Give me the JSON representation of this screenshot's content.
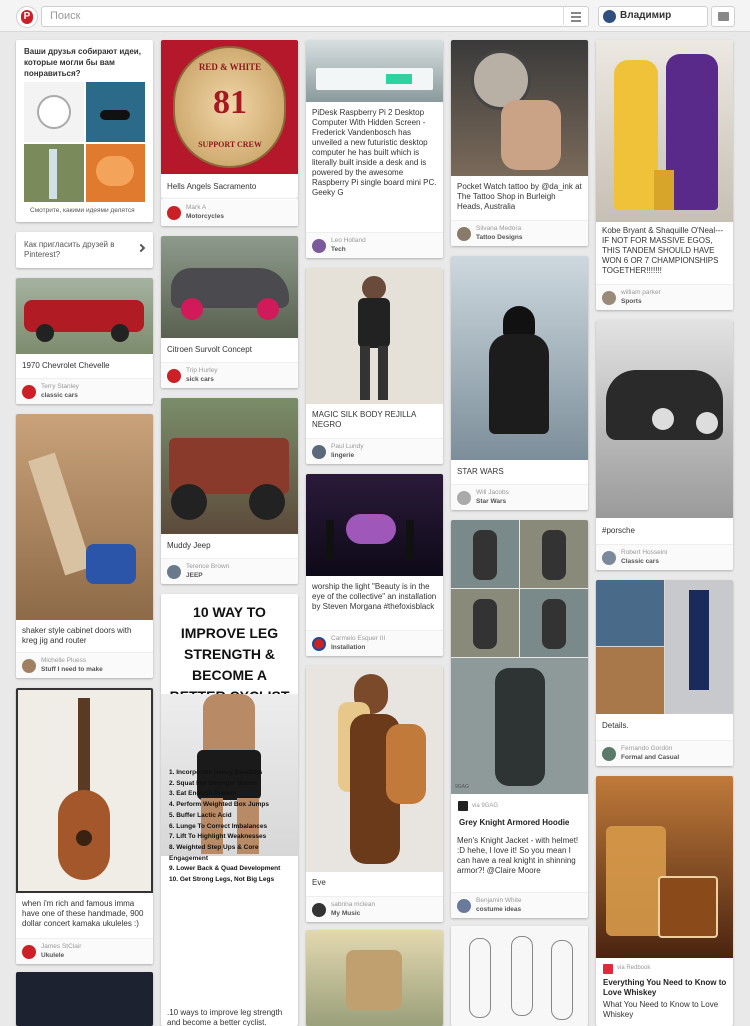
{
  "header": {
    "logo_letter": "P",
    "search_placeholder": "Поиск",
    "user_name": "Владимир"
  },
  "friends_card": {
    "title": "Ваши друзья собирают идеи, которые могли бы вам понравиться?",
    "footer": "Смотрите, какими идеями делятся"
  },
  "invite_card": {
    "label": "Как пригласить друзей в Pinterest?"
  },
  "pins": {
    "chevelle": {
      "desc": "1970 Chevrolet Chevelle",
      "by": "Terry Stanley",
      "board": "classic cars"
    },
    "hells_angels": {
      "desc": "Hells Angels Sacramento",
      "by": "Mark A",
      "board": "Motorcycles",
      "badge_top": "RED & WHITE",
      "badge_num": "81",
      "badge_bottom": "SUPPORT CREW"
    },
    "pidesk": {
      "desc": "PiDesk Raspberry Pi 2 Desktop Computer With Hidden Screen - Frederick Vandenbosch has unveiled a new futuristic desktop computer he has built which is literally built inside a desk and is powered by the awesome Raspberry Pi single board mini PC. Geeky G",
      "by": "Leo Holland",
      "board": "Tech"
    },
    "watch_tattoo": {
      "desc": "Pocket Watch tattoo by @da_ink at The Tattoo Shop in Burleigh Heads, Australia",
      "by": "Silvana Medora",
      "board": "Tattoo Designs"
    },
    "kobe": {
      "desc": "Kobe Bryant & Shaquille O'Neal--- IF NOT FOR MASSIVE EGOS, THIS TANDEM SHOULD HAVE WON 6 OR 7 CHAMPIONSHIPS TOGETHER!!!!!!!",
      "by": "william parker",
      "board": "Sports"
    },
    "survolt": {
      "desc": "Citroen Survolt Concept",
      "by": "Trip Hurley",
      "board": "sick cars"
    },
    "magic_silk": {
      "desc": "MAGIC SILK BODY REJILLA NEGRO",
      "by": "Paul Lundy",
      "board": "lingerie"
    },
    "star_wars": {
      "desc": "STAR WARS",
      "by": "Will Jacobs",
      "board": "Star Wars"
    },
    "porsche": {
      "desc": "#porsche",
      "by": "Robert Hosseini",
      "board": "Classic cars"
    },
    "cabinet": {
      "desc": "shaker style cabinet doors with kreg jig and router",
      "by": "Michelle Pluess",
      "board": "Stuff I need to make"
    },
    "muddy_jeep": {
      "desc": "Muddy Jeep",
      "by": "Terence Brown",
      "board": "JEEP"
    },
    "worship": {
      "desc": "worship the light \"Beauty is in the eye of the collective\" an installation by Steven Morgana #thefoxisblack",
      "by": "Carmelo Esquer III",
      "board": "Installation"
    },
    "details": {
      "desc": "Details.",
      "by": "Fernando Gordón",
      "board": "Formal and Casual"
    },
    "leg_strength": {
      "poster_title": "10 WAY TO IMPROVE LEG STRENGTH & BECOME A BETTER CYCLIST",
      "list": [
        "1. Incorporate Heavy Deadlifts",
        "2. Squat For Stronger Bones",
        "3. Eat Enough Protein",
        "4. Perform Weighted Box Jumps",
        "5. Buffer Lactic Acid",
        "6. Lunge To Correct Imbalances",
        "7. Lift To Highlight Weaknesses",
        "8. Weighted Step Ups & Core Engagement",
        "9. Lower Back & Quad Development",
        "10. Get Strong Legs, Not Big Legs"
      ],
      "desc": ".10 ways to improve leg strength and become a better cyclist."
    },
    "eve": {
      "desc": "Eve",
      "by": "sabrina mclean",
      "board": "My Music"
    },
    "hoodie": {
      "via": "via 9GAG",
      "title": "Grey Knight Armored Hoodie",
      "brand": "9GAG",
      "desc": "Men's Knight Jacket - with helmet! :D hehe, I love it! So you mean I can have a real knight in shinning armor?! @Claire Moore",
      "by": "Benjamin White",
      "board": "costume ideas"
    },
    "ukulele": {
      "desc": "when i'm rich and famous imma have one of these handmade, 900 dollar concert kamaka ukuleles :)",
      "by": "James StClair",
      "board": "Ukulele"
    },
    "whiskey": {
      "via": "via Redbook",
      "title": "Everything You Need to Know to Love Whiskey",
      "desc": "What You Need to Know to Love Whiskey"
    }
  }
}
